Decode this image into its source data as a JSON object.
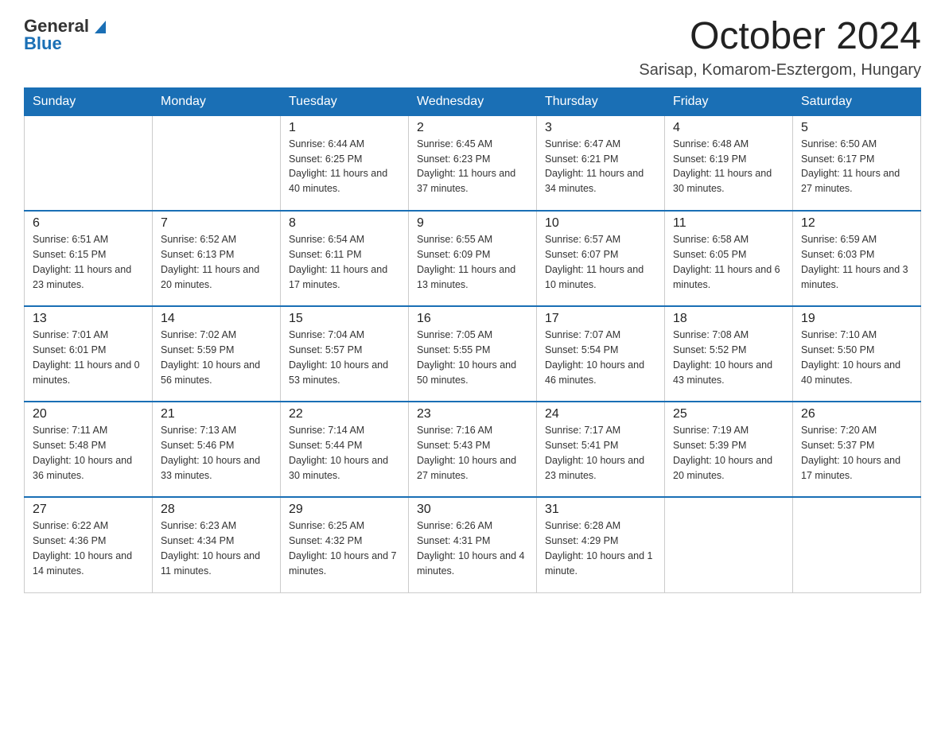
{
  "logo": {
    "text_general": "General",
    "text_blue": "Blue"
  },
  "title": "October 2024",
  "location": "Sarisap, Komarom-Esztergom, Hungary",
  "days_of_week": [
    "Sunday",
    "Monday",
    "Tuesday",
    "Wednesday",
    "Thursday",
    "Friday",
    "Saturday"
  ],
  "weeks": [
    [
      {
        "day": "",
        "sunrise": "",
        "sunset": "",
        "daylight": ""
      },
      {
        "day": "",
        "sunrise": "",
        "sunset": "",
        "daylight": ""
      },
      {
        "day": "1",
        "sunrise": "Sunrise: 6:44 AM",
        "sunset": "Sunset: 6:25 PM",
        "daylight": "Daylight: 11 hours and 40 minutes."
      },
      {
        "day": "2",
        "sunrise": "Sunrise: 6:45 AM",
        "sunset": "Sunset: 6:23 PM",
        "daylight": "Daylight: 11 hours and 37 minutes."
      },
      {
        "day": "3",
        "sunrise": "Sunrise: 6:47 AM",
        "sunset": "Sunset: 6:21 PM",
        "daylight": "Daylight: 11 hours and 34 minutes."
      },
      {
        "day": "4",
        "sunrise": "Sunrise: 6:48 AM",
        "sunset": "Sunset: 6:19 PM",
        "daylight": "Daylight: 11 hours and 30 minutes."
      },
      {
        "day": "5",
        "sunrise": "Sunrise: 6:50 AM",
        "sunset": "Sunset: 6:17 PM",
        "daylight": "Daylight: 11 hours and 27 minutes."
      }
    ],
    [
      {
        "day": "6",
        "sunrise": "Sunrise: 6:51 AM",
        "sunset": "Sunset: 6:15 PM",
        "daylight": "Daylight: 11 hours and 23 minutes."
      },
      {
        "day": "7",
        "sunrise": "Sunrise: 6:52 AM",
        "sunset": "Sunset: 6:13 PM",
        "daylight": "Daylight: 11 hours and 20 minutes."
      },
      {
        "day": "8",
        "sunrise": "Sunrise: 6:54 AM",
        "sunset": "Sunset: 6:11 PM",
        "daylight": "Daylight: 11 hours and 17 minutes."
      },
      {
        "day": "9",
        "sunrise": "Sunrise: 6:55 AM",
        "sunset": "Sunset: 6:09 PM",
        "daylight": "Daylight: 11 hours and 13 minutes."
      },
      {
        "day": "10",
        "sunrise": "Sunrise: 6:57 AM",
        "sunset": "Sunset: 6:07 PM",
        "daylight": "Daylight: 11 hours and 10 minutes."
      },
      {
        "day": "11",
        "sunrise": "Sunrise: 6:58 AM",
        "sunset": "Sunset: 6:05 PM",
        "daylight": "Daylight: 11 hours and 6 minutes."
      },
      {
        "day": "12",
        "sunrise": "Sunrise: 6:59 AM",
        "sunset": "Sunset: 6:03 PM",
        "daylight": "Daylight: 11 hours and 3 minutes."
      }
    ],
    [
      {
        "day": "13",
        "sunrise": "Sunrise: 7:01 AM",
        "sunset": "Sunset: 6:01 PM",
        "daylight": "Daylight: 11 hours and 0 minutes."
      },
      {
        "day": "14",
        "sunrise": "Sunrise: 7:02 AM",
        "sunset": "Sunset: 5:59 PM",
        "daylight": "Daylight: 10 hours and 56 minutes."
      },
      {
        "day": "15",
        "sunrise": "Sunrise: 7:04 AM",
        "sunset": "Sunset: 5:57 PM",
        "daylight": "Daylight: 10 hours and 53 minutes."
      },
      {
        "day": "16",
        "sunrise": "Sunrise: 7:05 AM",
        "sunset": "Sunset: 5:55 PM",
        "daylight": "Daylight: 10 hours and 50 minutes."
      },
      {
        "day": "17",
        "sunrise": "Sunrise: 7:07 AM",
        "sunset": "Sunset: 5:54 PM",
        "daylight": "Daylight: 10 hours and 46 minutes."
      },
      {
        "day": "18",
        "sunrise": "Sunrise: 7:08 AM",
        "sunset": "Sunset: 5:52 PM",
        "daylight": "Daylight: 10 hours and 43 minutes."
      },
      {
        "day": "19",
        "sunrise": "Sunrise: 7:10 AM",
        "sunset": "Sunset: 5:50 PM",
        "daylight": "Daylight: 10 hours and 40 minutes."
      }
    ],
    [
      {
        "day": "20",
        "sunrise": "Sunrise: 7:11 AM",
        "sunset": "Sunset: 5:48 PM",
        "daylight": "Daylight: 10 hours and 36 minutes."
      },
      {
        "day": "21",
        "sunrise": "Sunrise: 7:13 AM",
        "sunset": "Sunset: 5:46 PM",
        "daylight": "Daylight: 10 hours and 33 minutes."
      },
      {
        "day": "22",
        "sunrise": "Sunrise: 7:14 AM",
        "sunset": "Sunset: 5:44 PM",
        "daylight": "Daylight: 10 hours and 30 minutes."
      },
      {
        "day": "23",
        "sunrise": "Sunrise: 7:16 AM",
        "sunset": "Sunset: 5:43 PM",
        "daylight": "Daylight: 10 hours and 27 minutes."
      },
      {
        "day": "24",
        "sunrise": "Sunrise: 7:17 AM",
        "sunset": "Sunset: 5:41 PM",
        "daylight": "Daylight: 10 hours and 23 minutes."
      },
      {
        "day": "25",
        "sunrise": "Sunrise: 7:19 AM",
        "sunset": "Sunset: 5:39 PM",
        "daylight": "Daylight: 10 hours and 20 minutes."
      },
      {
        "day": "26",
        "sunrise": "Sunrise: 7:20 AM",
        "sunset": "Sunset: 5:37 PM",
        "daylight": "Daylight: 10 hours and 17 minutes."
      }
    ],
    [
      {
        "day": "27",
        "sunrise": "Sunrise: 6:22 AM",
        "sunset": "Sunset: 4:36 PM",
        "daylight": "Daylight: 10 hours and 14 minutes."
      },
      {
        "day": "28",
        "sunrise": "Sunrise: 6:23 AM",
        "sunset": "Sunset: 4:34 PM",
        "daylight": "Daylight: 10 hours and 11 minutes."
      },
      {
        "day": "29",
        "sunrise": "Sunrise: 6:25 AM",
        "sunset": "Sunset: 4:32 PM",
        "daylight": "Daylight: 10 hours and 7 minutes."
      },
      {
        "day": "30",
        "sunrise": "Sunrise: 6:26 AM",
        "sunset": "Sunset: 4:31 PM",
        "daylight": "Daylight: 10 hours and 4 minutes."
      },
      {
        "day": "31",
        "sunrise": "Sunrise: 6:28 AM",
        "sunset": "Sunset: 4:29 PM",
        "daylight": "Daylight: 10 hours and 1 minute."
      },
      {
        "day": "",
        "sunrise": "",
        "sunset": "",
        "daylight": ""
      },
      {
        "day": "",
        "sunrise": "",
        "sunset": "",
        "daylight": ""
      }
    ]
  ]
}
